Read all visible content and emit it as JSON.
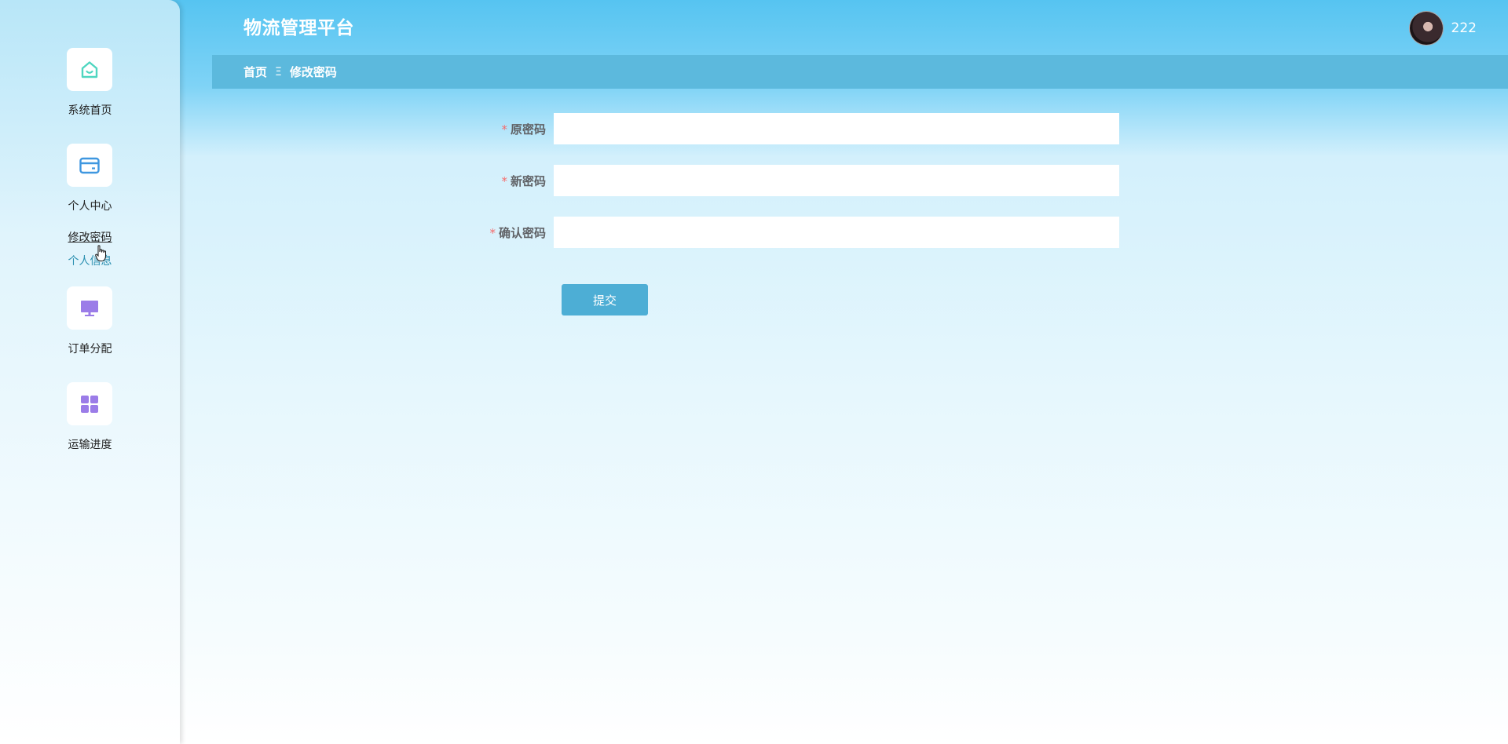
{
  "header": {
    "app_title": "物流管理平台",
    "username": "222"
  },
  "breadcrumb": {
    "home": "首页",
    "separator": "Ξ",
    "current": "修改密码"
  },
  "sidebar": {
    "items": [
      {
        "label": "系统首页",
        "icon": "home-icon",
        "icon_color": "#4fd6c0"
      },
      {
        "label": "个人中心",
        "icon": "card-icon",
        "icon_color": "#3f97e0"
      },
      {
        "label": "订单分配",
        "icon": "monitor-icon",
        "icon_color": "#9b7ce8"
      },
      {
        "label": "运输进度",
        "icon": "grid-icon",
        "icon_color": "#9b7ce8"
      }
    ],
    "submenu": [
      {
        "label": "修改密码"
      },
      {
        "label": "个人信息"
      }
    ]
  },
  "form": {
    "old_password": {
      "label": "原密码",
      "value": ""
    },
    "new_password": {
      "label": "新密码",
      "value": ""
    },
    "confirm_password": {
      "label": "确认密码",
      "value": ""
    },
    "required_mark": "*",
    "submit_label": "提交"
  },
  "colors": {
    "accent": "#4daed5",
    "breadcrumb_bg": "#5cb9dd",
    "required": "#f56c6c"
  }
}
